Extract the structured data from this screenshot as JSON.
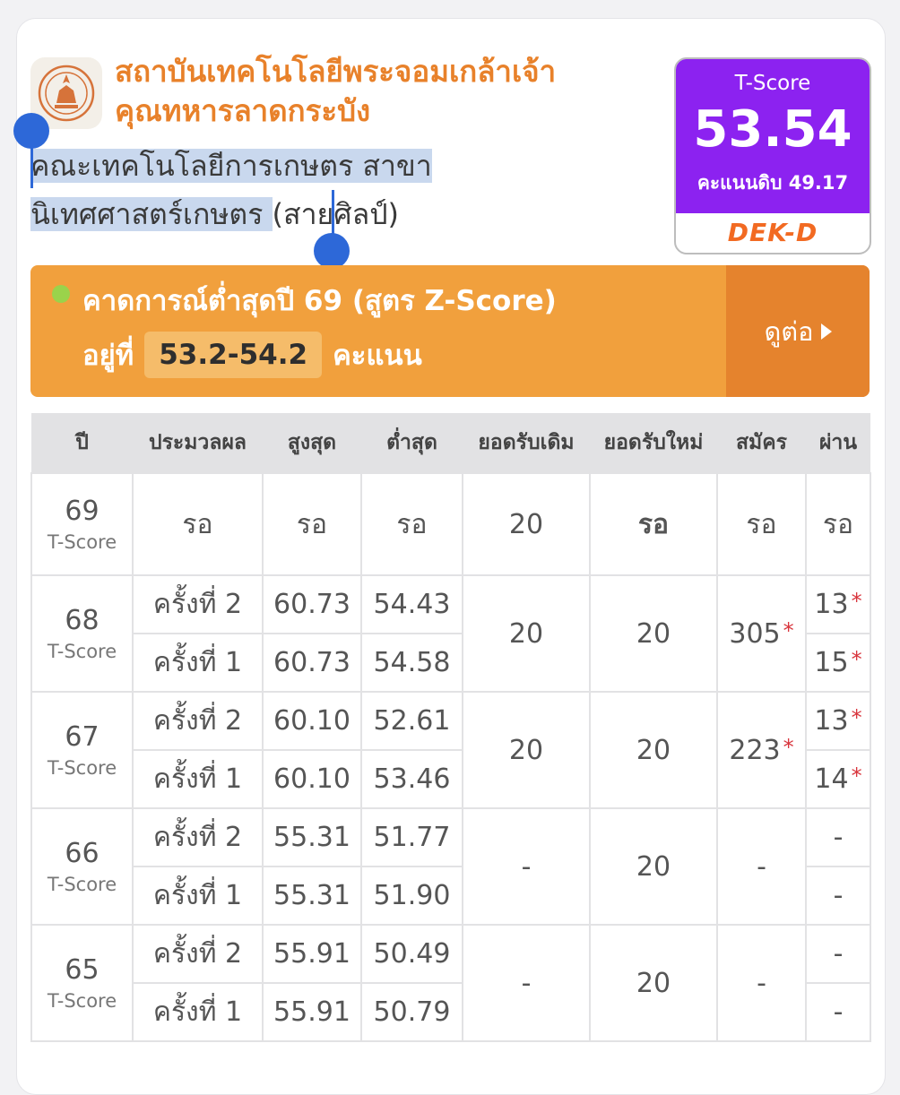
{
  "university": {
    "name": "สถาบันเทคโนโลยีพระจอมเกล้าเจ้า\nคุณทหารลาดกระบัง",
    "faculty_selected": "คณะเทคโนโลยีการเกษตร สาขา\nนิเทศศาสตร์เกษตร ",
    "faculty_rest": "(สายศิลป์)"
  },
  "score_box": {
    "label": "T-Score",
    "value": "53.54",
    "raw": "คะแนนดิบ 49.17",
    "brand": "DEK-D"
  },
  "prediction": {
    "line1": "คาดการณ์ต่ำสุดปี 69 (สูตร Z-Score)",
    "prefix": "อยู่ที่",
    "range": "53.2-54.2",
    "suffix": "คะแนน",
    "more": "ดูต่อ"
  },
  "colors": {
    "orange": "#e8812a",
    "purple": "#8c22f0",
    "green": "#8cc63f",
    "star": "#d8343c"
  },
  "table": {
    "headers": [
      "ปี",
      "ประมวลผล",
      "สูงสุด",
      "ต่ำสุด",
      "ยอดรับเดิม",
      "ยอดรับใหม่",
      "สมัคร",
      "ผ่าน"
    ],
    "year69": {
      "year": "69",
      "type": "T-Score",
      "round": "รอ",
      "max": "รอ",
      "min": "รอ",
      "old": "20",
      "new": "รอ",
      "applied": "รอ",
      "passed": "รอ"
    },
    "groups": [
      {
        "year": "68",
        "type": "T-Score",
        "old": "20",
        "new": "20",
        "applied": "305",
        "rows": [
          {
            "round": "ครั้งที่ 2",
            "max": "60.73",
            "min": "54.43",
            "passed": "13"
          },
          {
            "round": "ครั้งที่ 1",
            "max": "60.73",
            "min": "54.58",
            "passed": "15"
          }
        ]
      },
      {
        "year": "67",
        "type": "T-Score",
        "old": "20",
        "new": "20",
        "applied": "223",
        "rows": [
          {
            "round": "ครั้งที่ 2",
            "max": "60.10",
            "min": "52.61",
            "passed": "13"
          },
          {
            "round": "ครั้งที่ 1",
            "max": "60.10",
            "min": "53.46",
            "passed": "14"
          }
        ]
      },
      {
        "year": "66",
        "type": "T-Score",
        "old": "-",
        "new": "20",
        "applied": "-",
        "rows": [
          {
            "round": "ครั้งที่ 2",
            "max": "55.31",
            "min": "51.77",
            "passed": "-"
          },
          {
            "round": "ครั้งที่ 1",
            "max": "55.31",
            "min": "51.90",
            "passed": "-"
          }
        ]
      },
      {
        "year": "65",
        "type": "T-Score",
        "old": "-",
        "new": "20",
        "applied": "-",
        "rows": [
          {
            "round": "ครั้งที่ 2",
            "max": "55.91",
            "min": "50.49",
            "passed": "-"
          },
          {
            "round": "ครั้งที่ 1",
            "max": "55.91",
            "min": "50.79",
            "passed": "-"
          }
        ]
      }
    ],
    "star": "*"
  }
}
